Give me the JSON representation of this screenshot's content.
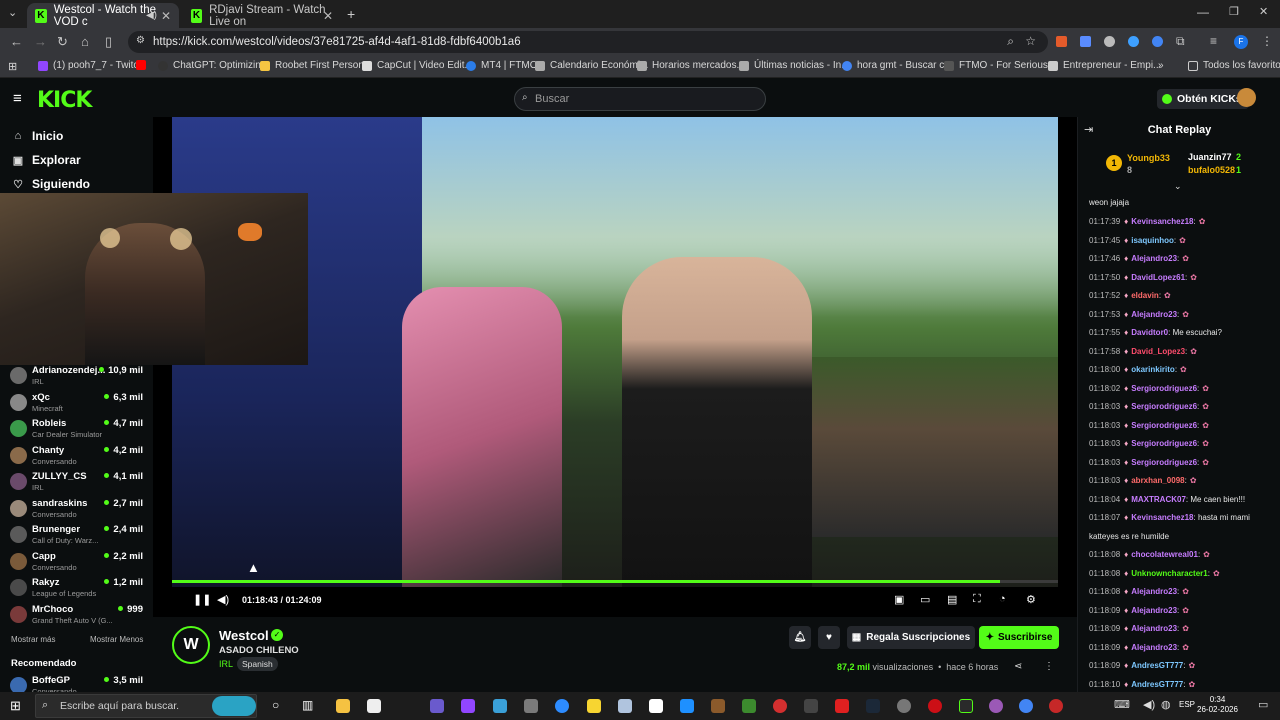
{
  "tabs": [
    {
      "title": "Westcol - Watch the VOD c"
    },
    {
      "title": "RDjavi Stream - Watch Live on "
    }
  ],
  "address": {
    "url": "https://kick.com/westcol/videos/37e81725-af4d-4af1-81d8-fdbf6400b1a6"
  },
  "bookmarks": [
    "(1) pooh7_7 - Twitch",
    "ChatGPT: Optimizin...",
    "Roobet First Person...",
    "CapCut | Video Edit...",
    "MT4 | FTMO",
    "Calendario Económi...",
    "Horarios mercados...",
    "Últimas noticias - In...",
    "hora gmt - Buscar c...",
    "FTMO - For Serious...",
    "Entrepreneur - Empi..."
  ],
  "bookmarks_all": "Todos los favoritos",
  "kick": {
    "logo": "KICK",
    "search_placeholder": "Buscar",
    "kicks_button": "Obtén KICKs"
  },
  "sidebar": {
    "nav": [
      {
        "label": "Inicio",
        "icon": "home-icon"
      },
      {
        "label": "Explorar",
        "icon": "compass-icon"
      },
      {
        "label": "Siguiendo",
        "icon": "heart-icon"
      }
    ],
    "channels": [
      {
        "name": "Adrianozendej...",
        "game": "IRL",
        "viewers": "10,9 mil"
      },
      {
        "name": "xQc",
        "game": "Minecraft",
        "viewers": "6,3 mil"
      },
      {
        "name": "Robleis",
        "game": "Car Dealer Simulator",
        "viewers": "4,7 mil"
      },
      {
        "name": "Chanty",
        "game": "Conversando",
        "viewers": "4,2 mil"
      },
      {
        "name": "ZULLYY_CS",
        "game": "IRL",
        "viewers": "4,1 mil"
      },
      {
        "name": "sandraskins",
        "game": "Conversando",
        "viewers": "2,7 mil"
      },
      {
        "name": "Brunenger",
        "game": "Call of Duty: Warz...",
        "viewers": "2,4 mil"
      },
      {
        "name": "Capp",
        "game": "Conversando",
        "viewers": "2,2 mil"
      },
      {
        "name": "Rakyz",
        "game": "League of Legends",
        "viewers": "1,2 mil"
      },
      {
        "name": "MrChoco",
        "game": "Grand Theft Auto V (G...",
        "viewers": "999"
      }
    ],
    "show_more": "Mostrar más",
    "show_less": "Mostrar Menos",
    "recommended_title": "Recomendado",
    "recommended": [
      {
        "name": "BoffeGP",
        "game": "Conversando",
        "viewers": "3,5 mil"
      }
    ]
  },
  "player": {
    "time": "01:18:43 / 01:24:09",
    "progress": 0.935
  },
  "stream": {
    "channel": "Westcol",
    "title": "ASADO CHILENO",
    "category": "IRL",
    "language": "Spanish",
    "gift_button": "Regala Suscripciones",
    "subscribe_button": "Suscribirse",
    "views_count": "87,2 mil",
    "views_label": "visualizaciones",
    "age": "hace 6 horas"
  },
  "chat": {
    "title": "Chat Replay",
    "top_gifters": [
      {
        "rank": "1",
        "name": "Youngb33",
        "count": "8"
      },
      {
        "name": "Juanzin77",
        "count": "2"
      },
      {
        "name": "bufalo0528",
        "count": "1"
      }
    ],
    "first_line": "weon jajaja",
    "messages": [
      {
        "time": "01:17:39",
        "user": "Kevinsanchez18",
        "color": "#c77dff",
        "text": ":"
      },
      {
        "time": "01:17:45",
        "user": "isaquinhoo",
        "color": "#7ec8ff",
        "text": ":"
      },
      {
        "time": "01:17:46",
        "user": "Alejandro23",
        "color": "#c77dff",
        "text": ":"
      },
      {
        "time": "01:17:50",
        "user": "DavidLopez61",
        "color": "#c77dff",
        "text": ":"
      },
      {
        "time": "01:17:52",
        "user": "eldavin",
        "color": "#ff6b6b",
        "text": ":"
      },
      {
        "time": "01:17:53",
        "user": "Alejandro23",
        "color": "#c77dff",
        "text": ":"
      },
      {
        "time": "01:17:55",
        "user": "Davidtor0",
        "color": "#c77dff",
        "text": ": Me escuchai?"
      },
      {
        "time": "01:17:58",
        "user": "David_Lopez3",
        "color": "#ff4d6d",
        "text": ":"
      },
      {
        "time": "01:18:00",
        "user": "okarinkirito",
        "color": "#7ec8ff",
        "text": ":"
      },
      {
        "time": "01:18:02",
        "user": "Sergiorodriguez6",
        "color": "#c77dff",
        "text": ":"
      },
      {
        "time": "01:18:03",
        "user": "Sergiorodriguez6",
        "color": "#c77dff",
        "text": ":"
      },
      {
        "time": "01:18:03",
        "user": "Sergiorodriguez6",
        "color": "#c77dff",
        "text": ":"
      },
      {
        "time": "01:18:03",
        "user": "Sergiorodriguez6",
        "color": "#c77dff",
        "text": ":"
      },
      {
        "time": "01:18:03",
        "user": "Sergiorodriguez6",
        "color": "#c77dff",
        "text": ":"
      },
      {
        "time": "01:18:03",
        "user": "abrxhan_0098",
        "color": "#ff6b6b",
        "text": ":"
      },
      {
        "time": "01:18:04",
        "user": "MAXTRACK07",
        "color": "#c77dff",
        "text": ": Me caen bien!!!"
      },
      {
        "time": "01:18:07",
        "user": "Kevinsanchez18",
        "color": "#c77dff",
        "text": ": hasta mi mami"
      },
      {
        "time": "",
        "user": "",
        "color": "#ffffff",
        "text": "katteyes es re humilde"
      },
      {
        "time": "01:18:08",
        "user": "chocolatewreal01",
        "color": "#c77dff",
        "text": ":"
      },
      {
        "time": "01:18:08",
        "user": "Unknowncharacter1",
        "color": "#53fc18",
        "text": ":"
      },
      {
        "time": "01:18:08",
        "user": "Alejandro23",
        "color": "#c77dff",
        "text": ":"
      },
      {
        "time": "01:18:09",
        "user": "Alejandro23",
        "color": "#c77dff",
        "text": ":"
      },
      {
        "time": "01:18:09",
        "user": "Alejandro23",
        "color": "#c77dff",
        "text": ":"
      },
      {
        "time": "01:18:09",
        "user": "Alejandro23",
        "color": "#c77dff",
        "text": ":"
      },
      {
        "time": "01:18:09",
        "user": "AndresGT777",
        "color": "#7ec8ff",
        "text": ":"
      },
      {
        "time": "01:18:10",
        "user": "AndresGT777",
        "color": "#7ec8ff",
        "text": ":"
      }
    ]
  },
  "taskbar": {
    "search_placeholder": "Escribe aquí para buscar.",
    "lang": "ESP",
    "time": "0:34",
    "date": "26-02-2026"
  }
}
